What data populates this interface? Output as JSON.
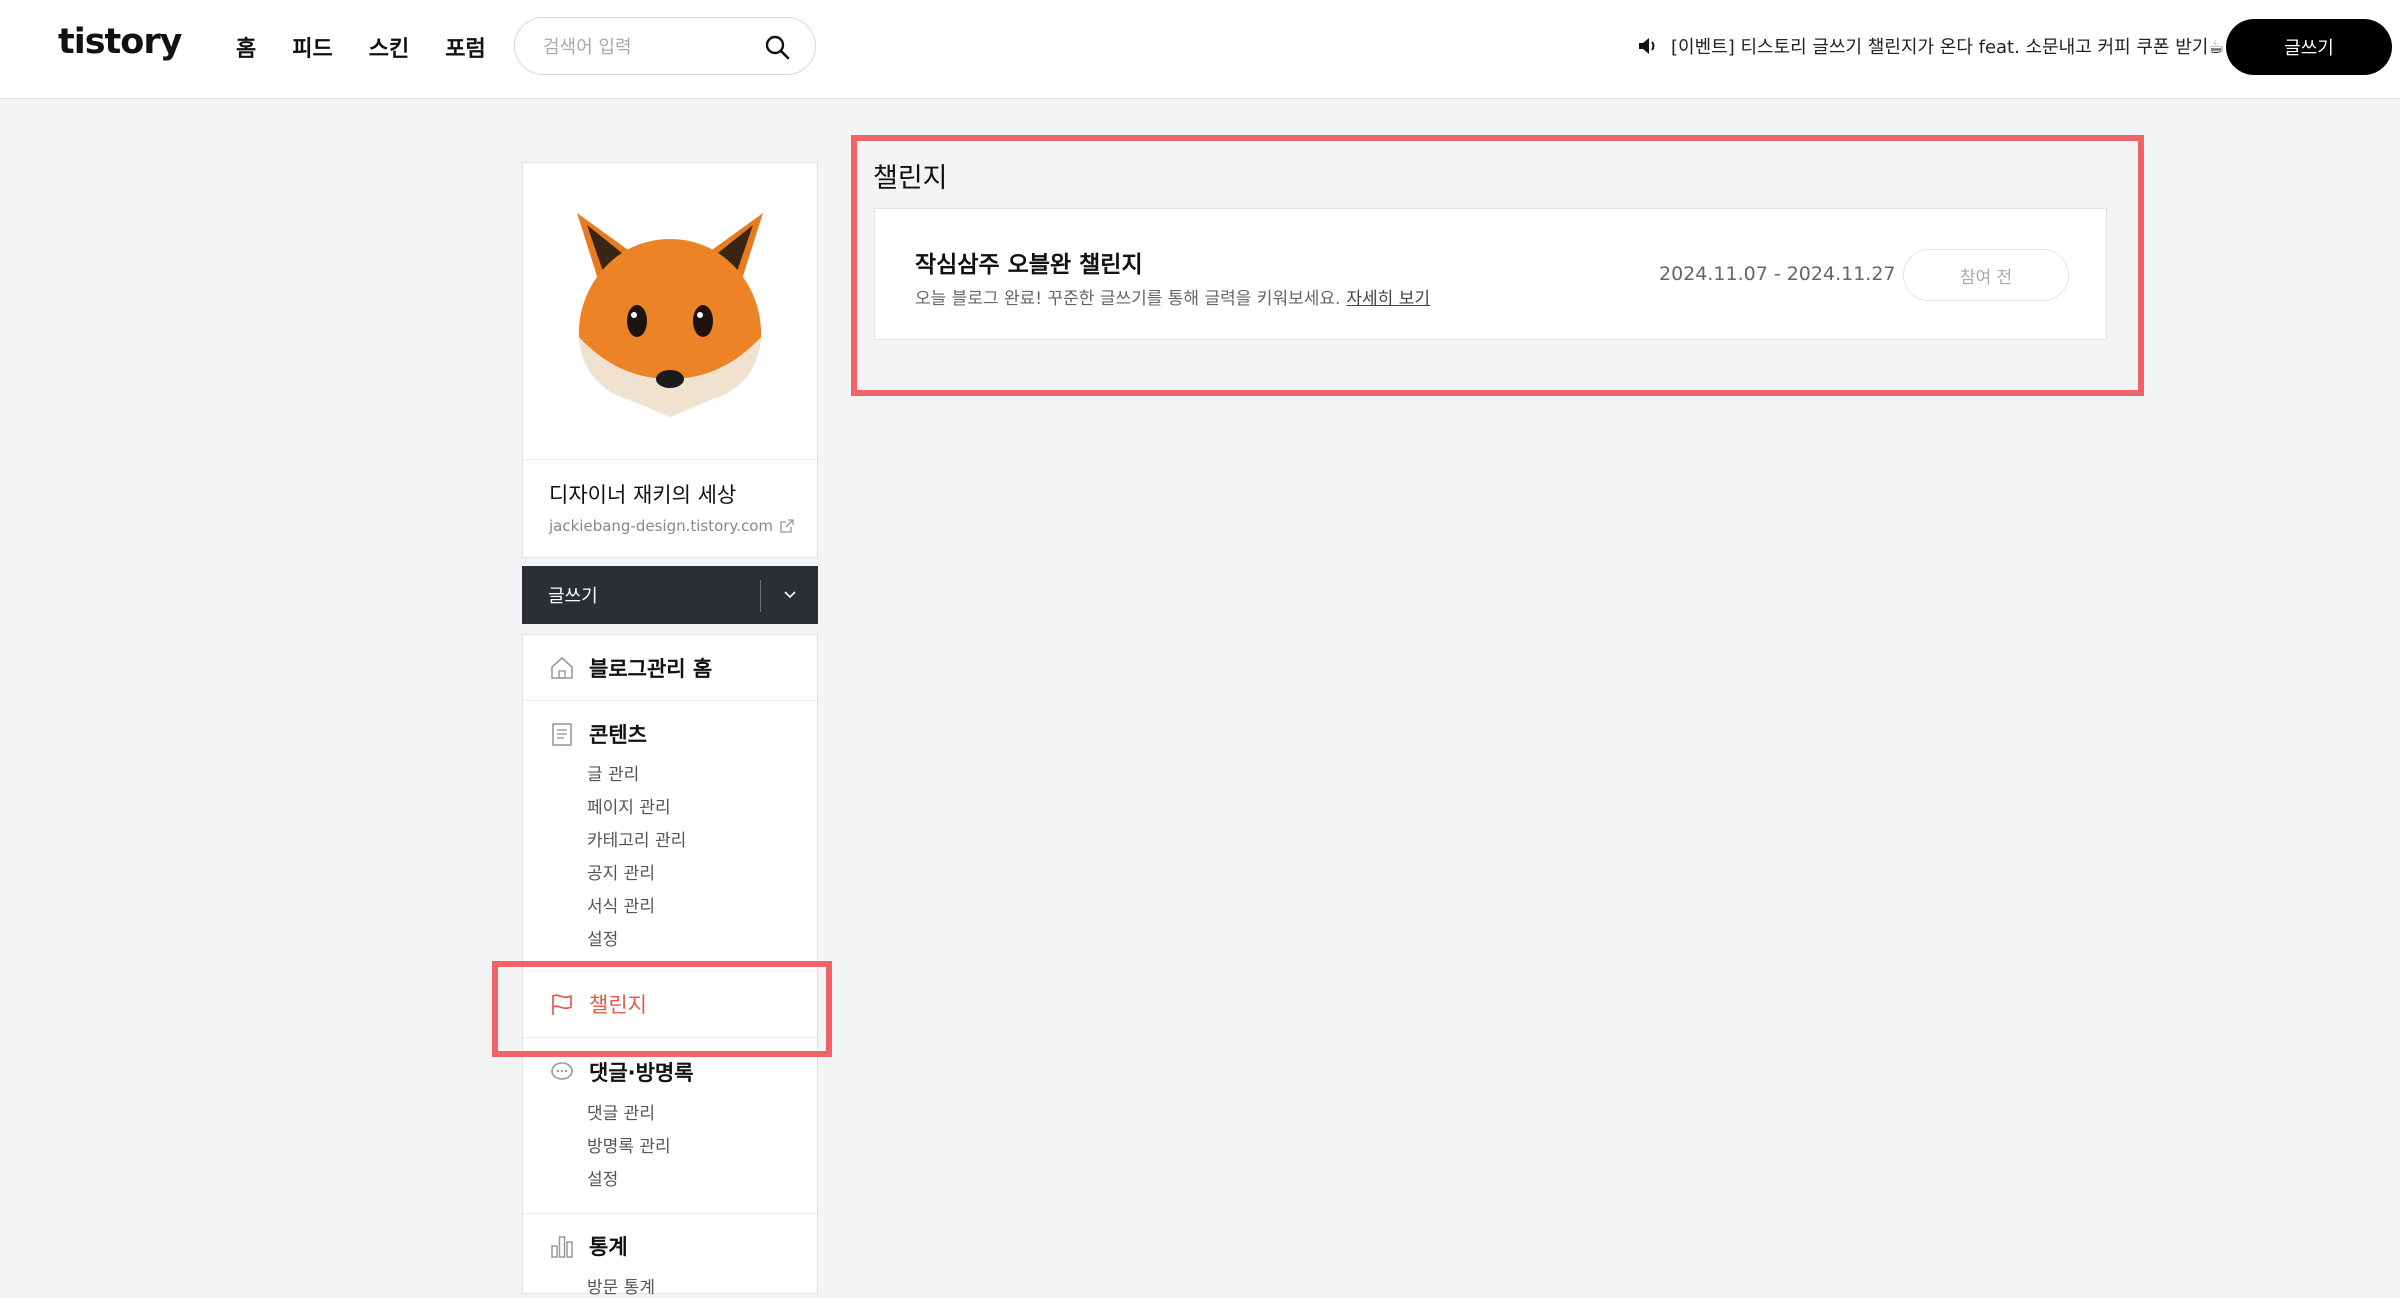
{
  "header": {
    "logo": "tistory",
    "nav": [
      "홈",
      "피드",
      "스킨",
      "포럼"
    ],
    "search_placeholder": "검색어 입력",
    "notice": "[이벤트] 티스토리 글쓰기 챌린지가 온다 feat. 소문내고 커피 쿠폰 받기☕",
    "write_button": "글쓰기"
  },
  "sidebar": {
    "blog_name": "디자이너 재키의 세상",
    "blog_url": "jackiebang-design.tistory.com",
    "write_label": "글쓰기",
    "menu": {
      "home": "블로그관리 홈",
      "contents": {
        "title": "콘텐츠",
        "items": [
          "글 관리",
          "페이지 관리",
          "카테고리 관리",
          "공지 관리",
          "서식 관리",
          "설정"
        ]
      },
      "challenge": "챌린지",
      "comments": {
        "title": "댓글·방명록",
        "items": [
          "댓글 관리",
          "방명록 관리",
          "설정"
        ]
      },
      "stats": {
        "title": "통계",
        "items": [
          "방문 통계"
        ]
      }
    }
  },
  "main": {
    "title": "챌린지",
    "challenge": {
      "name": "작심삼주 오블완 챌린지",
      "description": "오늘 블로그 완료! 꾸준한 글쓰기를 통해 글력을 키워보세요.",
      "link": "자세히 보기",
      "date": "2024.11.07 - 2024.11.27",
      "status": "참여 전"
    }
  },
  "colors": {
    "accent": "#e45a4c",
    "highlight": "#f06468",
    "dark_button": "#2b2e33"
  }
}
